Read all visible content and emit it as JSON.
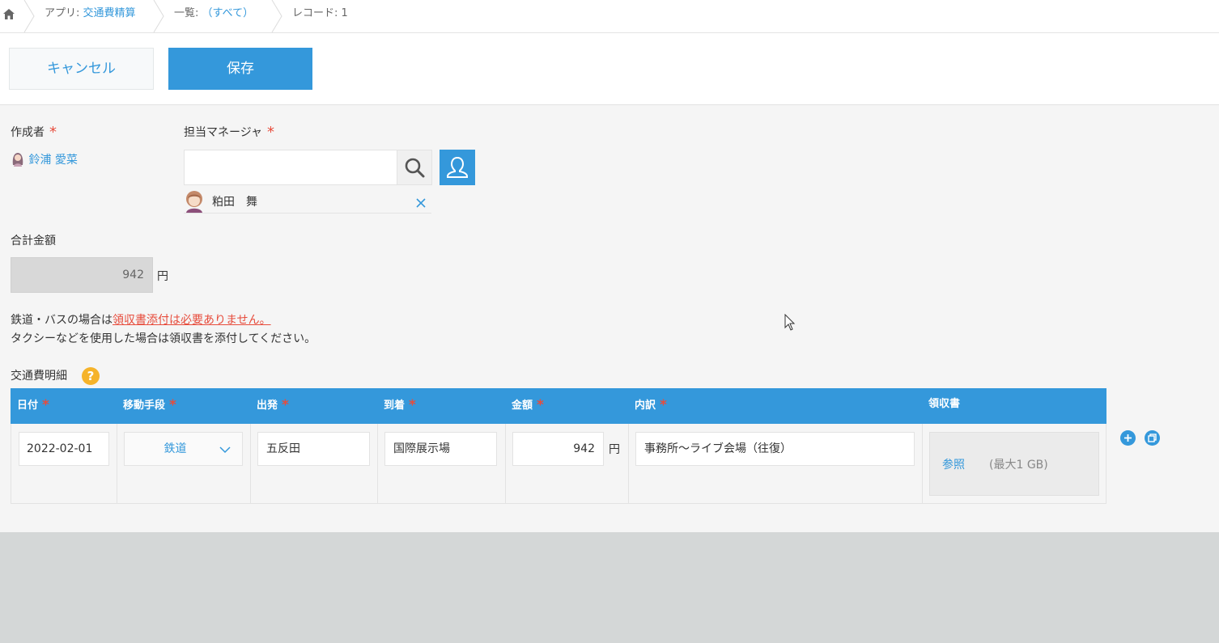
{
  "breadcrumb": {
    "app_prefix": "アプリ: ",
    "app_name": "交通費精算",
    "list_prefix": "一覧: ",
    "list_name": "（すべて）",
    "record": "レコード: 1"
  },
  "toolbar": {
    "cancel_label": "キャンセル",
    "save_label": "保存"
  },
  "form": {
    "author_label": "作成者",
    "author_name": "鈴浦 愛菜",
    "manager_label": "担当マネージャ",
    "manager_search_value": "",
    "manager_selected": "粕田　舞",
    "total_label": "合計金額",
    "total_value": "942",
    "total_unit": "円",
    "note_line1_prefix": "鉄道・バスの場合は",
    "note_line1_red": "領収書添付は必要ありません。",
    "note_line2": "タクシーなどを使用した場合は領収書を添付してください。",
    "table_label": "交通費明細",
    "help_icon_text": "?"
  },
  "table": {
    "headers": [
      "日付",
      "移動手段",
      "出発",
      "到着",
      "金額",
      "内訳",
      "領収書"
    ],
    "required": [
      true,
      true,
      true,
      true,
      true,
      true,
      false
    ],
    "row": {
      "date": "2022-02-01",
      "method": "鉄道",
      "departure": "五反田",
      "arrival": "国際展示場",
      "amount": "942",
      "amount_unit": "円",
      "detail": "事務所～ライブ会場（往復）",
      "browse_label": "参照",
      "max_size": "(最大1 GB)"
    }
  },
  "colors": {
    "accent": "#3498db",
    "required": "#e74c3c",
    "help": "#f5b32a"
  }
}
